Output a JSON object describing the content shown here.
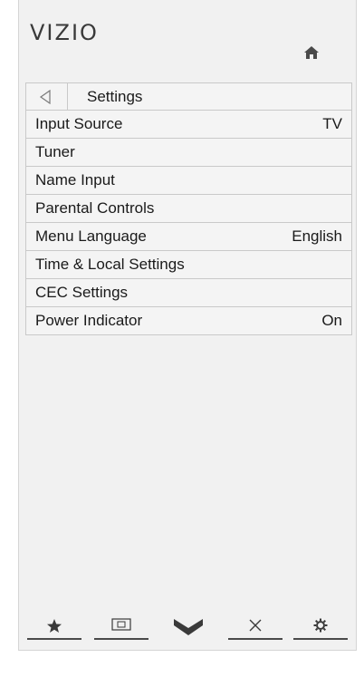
{
  "brand": {
    "logo_text": "VIZIO"
  },
  "header": {
    "title": "Settings"
  },
  "menu": {
    "items": [
      {
        "label": "Input Source",
        "value": "TV"
      },
      {
        "label": "Tuner",
        "value": ""
      },
      {
        "label": "Name Input",
        "value": ""
      },
      {
        "label": "Parental Controls",
        "value": ""
      },
      {
        "label": "Menu Language",
        "value": "English"
      },
      {
        "label": "Time & Local Settings",
        "value": ""
      },
      {
        "label": "CEC Settings",
        "value": ""
      },
      {
        "label": "Power Indicator",
        "value": "On"
      }
    ]
  },
  "bottom_nav": {
    "buttons": [
      {
        "icon": "star-icon"
      },
      {
        "icon": "picture-icon"
      },
      {
        "icon": "vizio-v-icon"
      },
      {
        "icon": "close-icon"
      },
      {
        "icon": "gear-icon"
      }
    ]
  },
  "colors": {
    "panel_bg": "#f1f1f1",
    "row_border": "#c9c9c9",
    "text": "#1a1a1a"
  }
}
